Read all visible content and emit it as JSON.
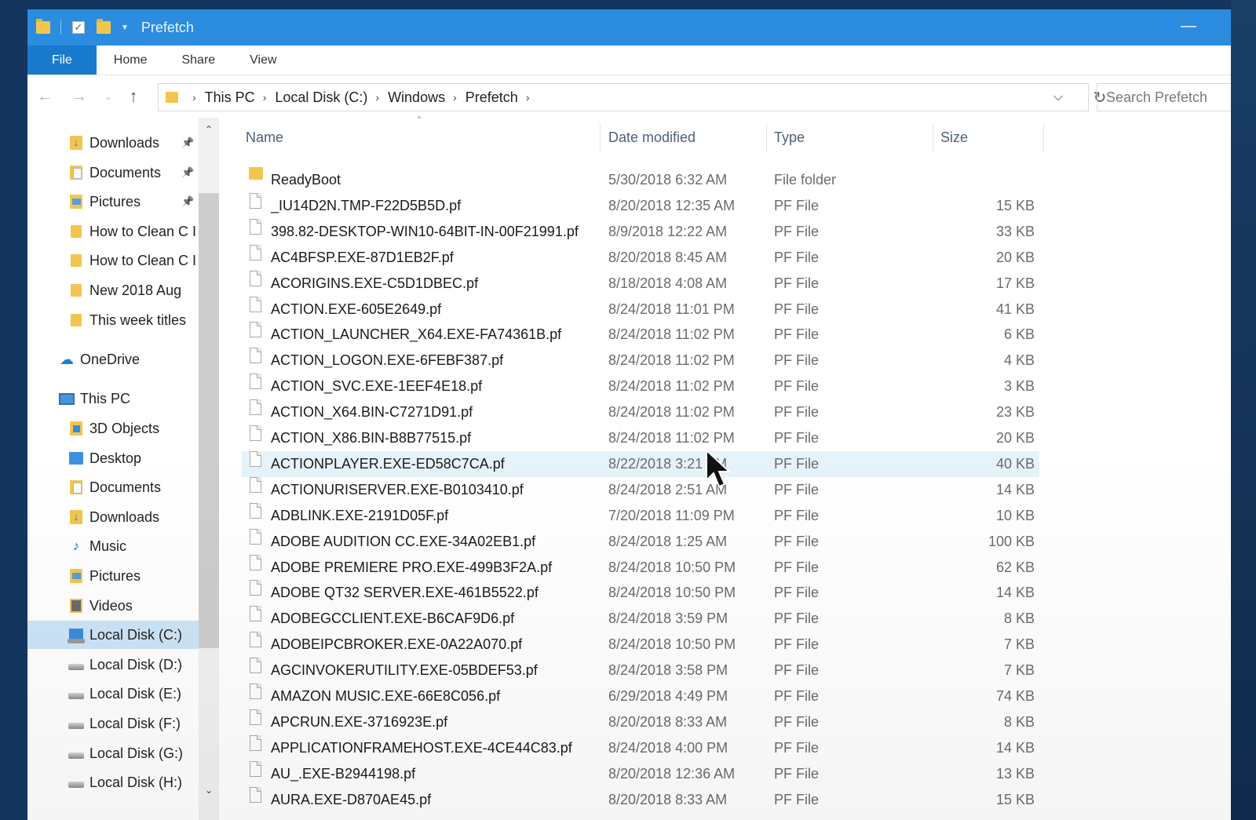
{
  "window": {
    "title": "Prefetch",
    "minimize_glyph": "—"
  },
  "ribbon": {
    "tabs": [
      "File",
      "Home",
      "Share",
      "View"
    ]
  },
  "address": {
    "crumbs": [
      "This PC",
      "Local Disk (C:)",
      "Windows",
      "Prefetch"
    ],
    "search_placeholder": "Search Prefetch"
  },
  "icons": {
    "back": "back-arrow-icon",
    "forward": "forward-arrow-icon",
    "up": "up-arrow-icon",
    "refresh": "refresh-icon",
    "pin": "pin-icon"
  },
  "nav": {
    "quick_access": [
      {
        "label": "Downloads",
        "icon": "downloads",
        "pinned": true
      },
      {
        "label": "Documents",
        "icon": "documents",
        "pinned": true
      },
      {
        "label": "Pictures",
        "icon": "pictures",
        "pinned": true
      },
      {
        "label": "How to Clean C I",
        "icon": "folder",
        "pinned": false
      },
      {
        "label": "How to Clean C I",
        "icon": "folder",
        "pinned": false
      },
      {
        "label": "New 2018 Aug",
        "icon": "folder",
        "pinned": false
      },
      {
        "label": "This week titles",
        "icon": "folder",
        "pinned": false
      }
    ],
    "onedrive": "OneDrive",
    "this_pc": "This PC",
    "this_pc_items": [
      {
        "label": "3D Objects",
        "icon": "3d"
      },
      {
        "label": "Desktop",
        "icon": "desktop"
      },
      {
        "label": "Documents",
        "icon": "documents"
      },
      {
        "label": "Downloads",
        "icon": "downloads"
      },
      {
        "label": "Music",
        "icon": "music"
      },
      {
        "label": "Pictures",
        "icon": "pictures"
      },
      {
        "label": "Videos",
        "icon": "videos"
      },
      {
        "label": "Local Disk (C:)",
        "icon": "sysdisk",
        "selected": true
      },
      {
        "label": "Local Disk (D:)",
        "icon": "disk"
      },
      {
        "label": "Local Disk (E:)",
        "icon": "disk"
      },
      {
        "label": "Local Disk (F:)",
        "icon": "disk"
      },
      {
        "label": "Local Disk  (G:)",
        "icon": "disk"
      },
      {
        "label": "Local Disk (H:)",
        "icon": "disk"
      }
    ]
  },
  "columns": [
    "Name",
    "Date modified",
    "Type",
    "Size"
  ],
  "files": [
    {
      "name": "ReadyBoot",
      "date": "5/30/2018 6:32 AM",
      "type": "File folder",
      "size": "",
      "folder": true
    },
    {
      "name": "_IU14D2N.TMP-F22D5B5D.pf",
      "date": "8/20/2018 12:35 AM",
      "type": "PF File",
      "size": "15 KB"
    },
    {
      "name": "398.82-DESKTOP-WIN10-64BIT-IN-00F21991.pf",
      "date": "8/9/2018 12:22 AM",
      "type": "PF File",
      "size": "33 KB"
    },
    {
      "name": "AC4BFSP.EXE-87D1EB2F.pf",
      "date": "8/20/2018 8:45 AM",
      "type": "PF File",
      "size": "20 KB"
    },
    {
      "name": "ACORIGINS.EXE-C5D1DBEC.pf",
      "date": "8/18/2018 4:08 AM",
      "type": "PF File",
      "size": "17 KB"
    },
    {
      "name": "ACTION.EXE-605E2649.pf",
      "date": "8/24/2018 11:01 PM",
      "type": "PF File",
      "size": "41 KB"
    },
    {
      "name": "ACTION_LAUNCHER_X64.EXE-FA74361B.pf",
      "date": "8/24/2018 11:02 PM",
      "type": "PF File",
      "size": "6 KB"
    },
    {
      "name": "ACTION_LOGON.EXE-6FEBF387.pf",
      "date": "8/24/2018 11:02 PM",
      "type": "PF File",
      "size": "4 KB"
    },
    {
      "name": "ACTION_SVC.EXE-1EEF4E18.pf",
      "date": "8/24/2018 11:02 PM",
      "type": "PF File",
      "size": "3 KB"
    },
    {
      "name": "ACTION_X64.BIN-C7271D91.pf",
      "date": "8/24/2018 11:02 PM",
      "type": "PF File",
      "size": "23 KB"
    },
    {
      "name": "ACTION_X86.BIN-B8B77515.pf",
      "date": "8/24/2018 11:02 PM",
      "type": "PF File",
      "size": "20 KB"
    },
    {
      "name": "ACTIONPLAYER.EXE-ED58C7CA.pf",
      "date": "8/22/2018 3:21 AM",
      "type": "PF File",
      "size": "40 KB",
      "hover": true
    },
    {
      "name": "ACTIONURISERVER.EXE-B0103410.pf",
      "date": "8/24/2018 2:51 AM",
      "type": "PF File",
      "size": "14 KB"
    },
    {
      "name": "ADBLINK.EXE-2191D05F.pf",
      "date": "7/20/2018 11:09 PM",
      "type": "PF File",
      "size": "10 KB"
    },
    {
      "name": "ADOBE AUDITION CC.EXE-34A02EB1.pf",
      "date": "8/24/2018 1:25 AM",
      "type": "PF File",
      "size": "100 KB"
    },
    {
      "name": "ADOBE PREMIERE PRO.EXE-499B3F2A.pf",
      "date": "8/24/2018 10:50 PM",
      "type": "PF File",
      "size": "62 KB"
    },
    {
      "name": "ADOBE QT32 SERVER.EXE-461B5522.pf",
      "date": "8/24/2018 10:50 PM",
      "type": "PF File",
      "size": "14 KB"
    },
    {
      "name": "ADOBEGCCLIENT.EXE-B6CAF9D6.pf",
      "date": "8/24/2018 3:59 PM",
      "type": "PF File",
      "size": "8 KB"
    },
    {
      "name": "ADOBEIPCBROKER.EXE-0A22A070.pf",
      "date": "8/24/2018 10:50 PM",
      "type": "PF File",
      "size": "7 KB"
    },
    {
      "name": "AGCINVOKERUTILITY.EXE-05BDEF53.pf",
      "date": "8/24/2018 3:58 PM",
      "type": "PF File",
      "size": "7 KB"
    },
    {
      "name": "AMAZON MUSIC.EXE-66E8C056.pf",
      "date": "6/29/2018 4:49 PM",
      "type": "PF File",
      "size": "74 KB"
    },
    {
      "name": "APCRUN.EXE-3716923E.pf",
      "date": "8/20/2018 8:33 AM",
      "type": "PF File",
      "size": "8 KB"
    },
    {
      "name": "APPLICATIONFRAMEHOST.EXE-4CE44C83.pf",
      "date": "8/24/2018 4:00 PM",
      "type": "PF File",
      "size": "14 KB"
    },
    {
      "name": "AU_.EXE-B2944198.pf",
      "date": "8/20/2018 12:36 AM",
      "type": "PF File",
      "size": "13 KB"
    },
    {
      "name": "AURA.EXE-D870AE45.pf",
      "date": "8/20/2018 8:33 AM",
      "type": "PF File",
      "size": "15 KB"
    }
  ]
}
